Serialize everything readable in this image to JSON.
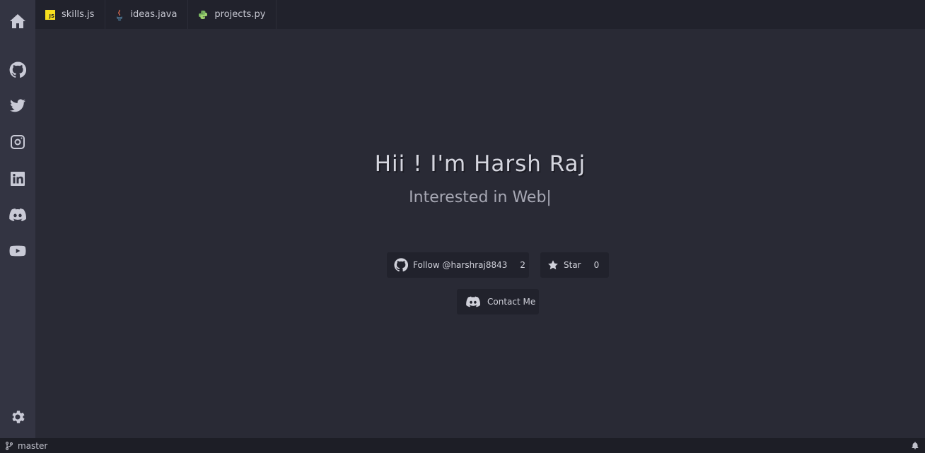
{
  "sidebar": {
    "items": [
      {
        "icon": "home-icon"
      },
      {
        "icon": "github-icon"
      },
      {
        "icon": "twitter-icon"
      },
      {
        "icon": "instagram-icon"
      },
      {
        "icon": "linkedin-icon"
      },
      {
        "icon": "discord-icon"
      },
      {
        "icon": "youtube-icon"
      }
    ],
    "settings_icon": "gear-icon"
  },
  "tabs": [
    {
      "label": "skills.js",
      "icon": "javascript-icon"
    },
    {
      "label": "ideas.java",
      "icon": "java-icon"
    },
    {
      "label": "projects.py",
      "icon": "python-icon"
    }
  ],
  "hero": {
    "title": "Hii ! I'm Harsh Raj",
    "subtitle": "Interested in Web|"
  },
  "buttons": {
    "follow_label": "Follow @harshraj8843",
    "follow_count": "2",
    "star_label": "Star",
    "star_count": "0",
    "contact_label": "Contact Me"
  },
  "status_bar": {
    "branch": "master"
  },
  "colors": {
    "background": "#292a35",
    "sidebar": "#333442",
    "tabbar": "#21222c",
    "js_yellow": "#f7df1e"
  }
}
